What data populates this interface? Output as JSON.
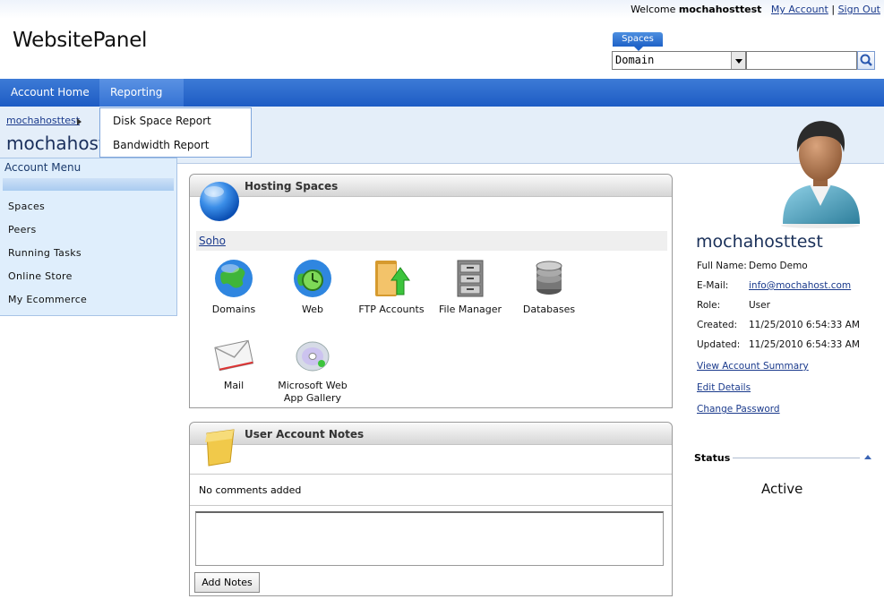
{
  "header": {
    "welcome_prefix": "Welcome",
    "username": "mochahosttest",
    "my_account": "My Account",
    "separator": "|",
    "sign_out": "Sign Out",
    "logo": "WebsitePanel"
  },
  "search": {
    "tab_label": "Spaces",
    "scope_value": "Domain",
    "query_value": ""
  },
  "nav": {
    "items": [
      {
        "label": "Account Home"
      },
      {
        "label": "Reporting"
      }
    ],
    "reporting_menu": [
      {
        "label": "Disk Space Report"
      },
      {
        "label": "Bandwidth Report"
      }
    ]
  },
  "breadcrumb": {
    "link": "mochahosttest",
    "page_title": "mochahosttest"
  },
  "account_menu": {
    "title": "Account Menu",
    "items": [
      {
        "label": "Spaces"
      },
      {
        "label": "Peers"
      },
      {
        "label": "Running Tasks"
      },
      {
        "label": "Online Store"
      },
      {
        "label": "My Ecommerce"
      }
    ]
  },
  "hosting_spaces": {
    "title": "Hosting Spaces",
    "space_name": "Soho",
    "tiles": [
      {
        "label": "Domains",
        "icon": "globe-icon"
      },
      {
        "label": "Web",
        "icon": "web-globe-icon"
      },
      {
        "label": "FTP Accounts",
        "icon": "ftp-folder-icon"
      },
      {
        "label": "File Manager",
        "icon": "file-cabinet-icon"
      },
      {
        "label": "Databases",
        "icon": "database-icon"
      },
      {
        "label": "Mail",
        "icon": "mail-envelope-icon"
      },
      {
        "label": "Microsoft Web App Gallery",
        "icon": "cd-disc-icon"
      }
    ]
  },
  "notes": {
    "title": "User Account Notes",
    "empty_text": "No comments added",
    "textarea_value": "",
    "add_button": "Add Notes"
  },
  "profile": {
    "name": "mochahosttest",
    "fields": [
      {
        "label": "Full Name:",
        "value": "Demo Demo"
      },
      {
        "label": "E-Mail:",
        "value": "info@mochahost.com"
      },
      {
        "label": "Role:",
        "value": "User"
      },
      {
        "label": "Created:",
        "value": "11/25/2010 6:54:33 AM"
      },
      {
        "label": "Updated:",
        "value": "11/25/2010 6:54:33 AM"
      }
    ],
    "links": [
      {
        "label": "View Account Summary"
      },
      {
        "label": "Edit Details"
      },
      {
        "label": "Change Password"
      }
    ]
  },
  "status": {
    "label": "Status",
    "value": "Active"
  },
  "colors": {
    "nav_blue": "#1d5cc4",
    "link_blue": "#1a3a8c",
    "band": "#e4eef9"
  }
}
